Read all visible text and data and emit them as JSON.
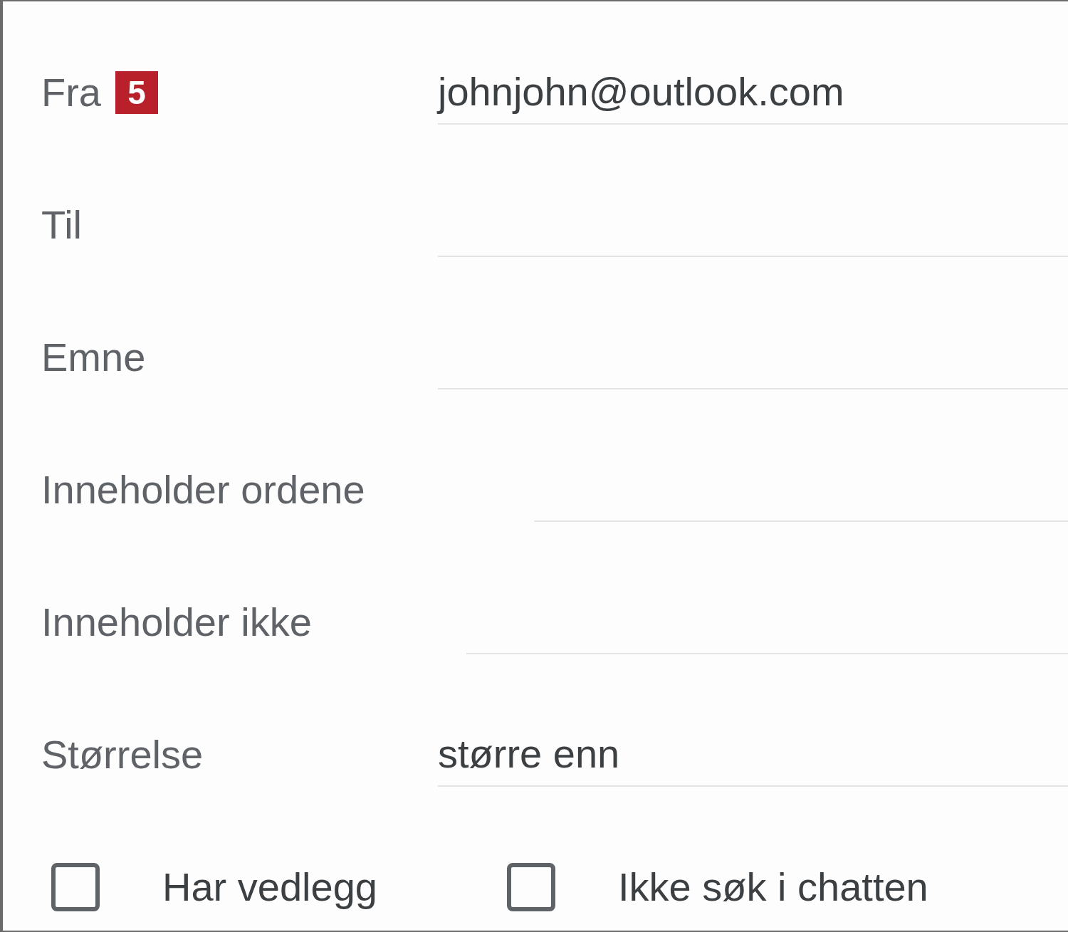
{
  "fields": [
    {
      "label": "Fra",
      "badge": "5",
      "value": "johnjohn@outlook.com"
    },
    {
      "label": "Til"
    },
    {
      "label": "Emne"
    },
    {
      "label": "Inneholder ordene"
    },
    {
      "label": "Inneholder ikke"
    },
    {
      "label": "Størrelse",
      "value": "større enn"
    }
  ],
  "checkboxes": [
    {
      "label": "Har vedlegg",
      "checked": false
    },
    {
      "label": "Ikke søk i chatten",
      "checked": false
    }
  ]
}
